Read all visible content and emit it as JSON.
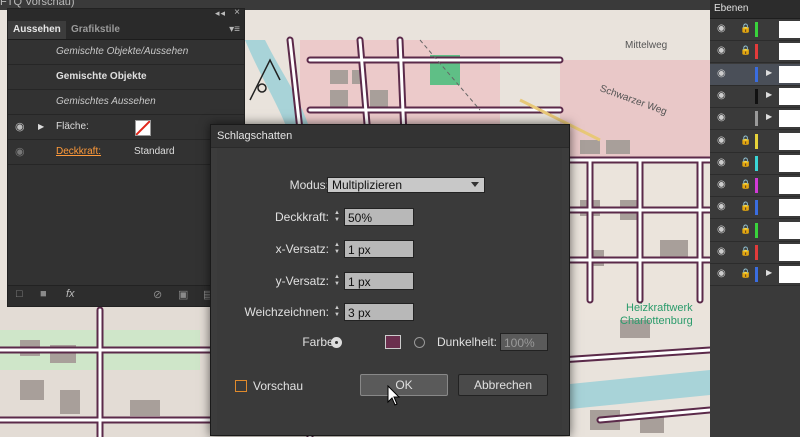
{
  "document": {
    "title": "FTQ Vorschau)"
  },
  "map": {
    "labels": [
      "Mittelweg",
      "Schwarzer Weg",
      "Heizkraftwerk",
      "Charlottenburg"
    ]
  },
  "appearance_panel": {
    "tabs": [
      "Aussehen",
      "Grafikstile"
    ],
    "rows": {
      "mixed_objects_appearance": "Gemischte Objekte/Aussehen",
      "mixed_objects": "Gemischte Objekte",
      "mixed_appearance": "Gemischtes Aussehen"
    },
    "fill_label": "Fläche:",
    "opacity_label": "Deckkraft:",
    "opacity_value": "Standard",
    "fx_label": "fx"
  },
  "layers_panel": {
    "title": "Ebenen",
    "rows": [
      {
        "color": "#39d23c",
        "locked": true,
        "expandable": false,
        "selected": false
      },
      {
        "color": "#e23b3b",
        "locked": true,
        "expandable": false,
        "selected": false
      },
      {
        "color": "#3a6de0",
        "locked": false,
        "expandable": true,
        "selected": true
      },
      {
        "color": "#111111",
        "locked": false,
        "expandable": true,
        "selected": false
      },
      {
        "color": "#9a9a9a",
        "locked": false,
        "expandable": true,
        "selected": false
      },
      {
        "color": "#e6d23a",
        "locked": true,
        "expandable": false,
        "selected": false
      },
      {
        "color": "#3ad6d6",
        "locked": true,
        "expandable": false,
        "selected": false
      },
      {
        "color": "#d23ad6",
        "locked": true,
        "expandable": false,
        "selected": false
      },
      {
        "color": "#3a6de0",
        "locked": true,
        "expandable": false,
        "selected": false
      },
      {
        "color": "#39d23c",
        "locked": true,
        "expandable": false,
        "selected": false
      },
      {
        "color": "#e23b3b",
        "locked": true,
        "expandable": false,
        "selected": false
      },
      {
        "color": "#3a6de0",
        "locked": true,
        "expandable": true,
        "selected": false
      }
    ]
  },
  "dialog": {
    "title": "Schlagschatten",
    "mode_label": "Modus:",
    "mode_value": "Multiplizieren",
    "opacity_label": "Deckkraft:",
    "opacity_value": "50%",
    "x_offset_label": "x-Versatz:",
    "x_offset_value": "1 px",
    "y_offset_label": "y-Versatz:",
    "y_offset_value": "1 px",
    "blur_label": "Weichzeichnen:",
    "blur_value": "3 px",
    "color_label": "Farbe:",
    "color_value": "#6b2f4e",
    "darkness_label": "Dunkelheit:",
    "darkness_value": "100%",
    "preview_label": "Vorschau",
    "ok_label": "OK",
    "cancel_label": "Abbrechen"
  }
}
